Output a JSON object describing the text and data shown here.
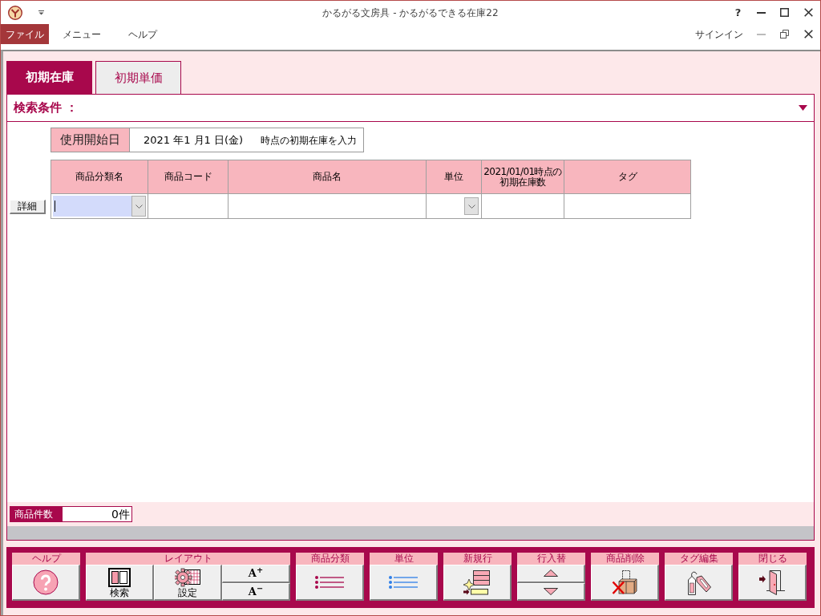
{
  "window": {
    "title": "かるがる文房具 - かるがるできる在庫22",
    "help": "?"
  },
  "menu_bar": {
    "items": [
      {
        "label": "ファイル",
        "kind": "file"
      },
      {
        "label": "メニュー",
        "kind": "menu"
      },
      {
        "label": "ヘルプ",
        "kind": "menu"
      }
    ],
    "account": "サインイン"
  },
  "tabs": [
    {
      "label": "初期在庫",
      "selected": true
    },
    {
      "label": "初期単価",
      "selected": false
    }
  ],
  "search_panel": {
    "title": "検索条件 ："
  },
  "start_date": {
    "label": "使用開始日",
    "value": "2021 年1 月1 日(金)",
    "note": "時点の初期在庫を入力"
  },
  "table": {
    "columns": [
      "商品分類名",
      "商品コード",
      "商品名",
      "単位",
      "2021/01/01時点の初期在庫数",
      "タグ"
    ],
    "new_row": {
      "button": "詳細",
      "cells": [
        {
          "kind": "combo",
          "focused": true
        },
        {
          "kind": "text"
        },
        {
          "kind": "text"
        },
        {
          "kind": "combo",
          "focused": false
        },
        {
          "kind": "text"
        },
        {
          "kind": "text"
        }
      ]
    }
  },
  "count": {
    "label": "商品件数",
    "value": "0件"
  },
  "toolbar": {
    "groups": [
      {
        "label": "ヘルプ",
        "buttons": [
          {
            "kind": "icon"
          }
        ]
      },
      {
        "label": "レイアウト",
        "buttons": [
          {
            "kind": "labeled",
            "label": "検索"
          },
          {
            "kind": "labeled",
            "label": "設定"
          },
          {
            "kind": "stack",
            "top": "A$^{+}$",
            "bottom": "A$^{−}$"
          }
        ]
      },
      {
        "label": "商品分類",
        "buttons": [
          {
            "kind": "icon"
          }
        ]
      },
      {
        "label": "単位",
        "buttons": [
          {
            "kind": "icon"
          }
        ]
      },
      {
        "label": "新規行",
        "buttons": [
          {
            "kind": "icon"
          }
        ]
      },
      {
        "label": "行入替",
        "buttons": [
          {
            "kind": "updown"
          }
        ]
      },
      {
        "label": "商品削除",
        "buttons": [
          {
            "kind": "icon"
          }
        ]
      },
      {
        "label": "タグ編集",
        "buttons": [
          {
            "kind": "icon"
          }
        ]
      },
      {
        "label": "閉じる",
        "buttons": [
          {
            "kind": "icon"
          }
        ]
      }
    ]
  }
}
